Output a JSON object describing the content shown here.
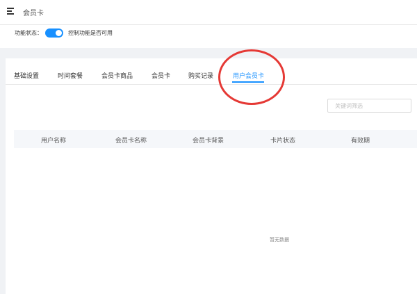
{
  "header": {
    "title": "会员卡",
    "menu_icon": "menu-fold-icon"
  },
  "status_panel": {
    "label": "功能状态：",
    "toggle_on": true,
    "hint": "控制功能是否可用",
    "accent_color": "#1890ff"
  },
  "tabs": [
    {
      "label": "基础设置",
      "active": false
    },
    {
      "label": "时间套餐",
      "active": false
    },
    {
      "label": "会员卡商品",
      "active": false
    },
    {
      "label": "会员卡",
      "active": false
    },
    {
      "label": "购买记录",
      "active": false
    },
    {
      "label": "用户会员卡",
      "active": true
    }
  ],
  "annotation": {
    "color": "#e53935",
    "shape": "circle"
  },
  "search": {
    "value": "",
    "placeholder": "关键词筛选"
  },
  "table": {
    "columns": [
      "用户名称",
      "会员卡名称",
      "会员卡背景",
      "卡片状态",
      "有效期"
    ],
    "rows": [],
    "empty_text": "暂无数据"
  }
}
